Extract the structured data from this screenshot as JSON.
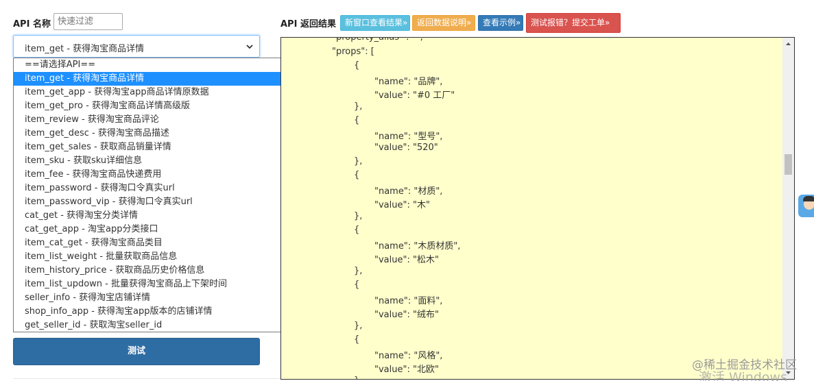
{
  "left": {
    "api_label": "API 名称",
    "filter_placeholder": "快速过滤",
    "selected_value": "item_get - 获得淘宝商品详情",
    "options": [
      "==请选择API==",
      "item_get - 获得淘宝商品详情",
      "item_get_app - 获得淘宝app商品详情原数据",
      "item_get_pro - 获得淘宝商品详情高级版",
      "item_review - 获得淘宝商品评论",
      "item_get_desc - 获得淘宝商品描述",
      "item_get_sales - 获取商品销量详情",
      "item_sku - 获取sku详细信息",
      "item_fee - 获得淘宝商品快递费用",
      "item_password - 获得淘口令真实url",
      "item_password_vip - 获得淘口令真实url",
      "cat_get - 获得淘宝分类详情",
      "cat_get_app - 淘宝app分类接口",
      "item_cat_get - 获得淘宝商品类目",
      "item_list_weight - 批量获取商品信息",
      "item_history_price - 获取商品历史价格信息",
      "item_list_updown - 批量获得淘宝商品上下架时间",
      "seller_info - 获得淘宝店铺详情",
      "shop_info_app - 获得淘宝app版本的店铺详情",
      "get_seller_id - 获取淘宝seller_id"
    ],
    "selected_index": 1,
    "test_button": "测试"
  },
  "right": {
    "result_label": "API 返回结果",
    "buttons": {
      "new_window": "新窗口查看结果»",
      "return_doc": "返回数据说明»",
      "view_example": "查看示例»",
      "report_error": "测试报错？提交工单»"
    },
    "json_lines": [
      "\"property_alias\" : \"\",",
      "\"props\": [",
      "{",
      "\"name\": \"品牌\",",
      "\"value\": \"#0 工厂\"",
      "},",
      "{",
      "\"name\": \"型号\",",
      "\"value\": \"520\"",
      "},",
      "{",
      "\"name\": \"材质\",",
      "\"value\": \"木\"",
      "},",
      "{",
      "\"name\": \"木质材质\",",
      "\"value\": \"松木\"",
      "},",
      "{",
      "\"name\": \"面料\",",
      "\"value\": \"绒布\"",
      "},",
      "{",
      "\"name\": \"风格\",",
      "\"value\": \"北欧\"",
      "},"
    ]
  },
  "watermark": {
    "line1": "@稀土掘金技术社区",
    "line2": "激活 Windows"
  },
  "colors": {
    "primary": "#2e6da4",
    "info": "#5bc0de",
    "warning": "#f0ad4e",
    "danger": "#d9534f",
    "selected": "#1e90ff",
    "result_bg": "#ffffcc"
  }
}
